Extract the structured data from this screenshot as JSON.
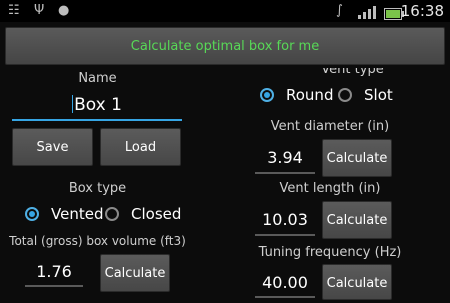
{
  "status": {
    "time": "16:38",
    "icons": [
      "usb-icon",
      "usb-debug-icon",
      "android-icon",
      "bluetooth-icon",
      "signal-icon",
      "battery-icon"
    ]
  },
  "header": {
    "calc_optimal_label": "Calculate optimal box for me"
  },
  "left": {
    "name_label": "Name",
    "name_value": "Box 1",
    "save_label": "Save",
    "load_label": "Load",
    "box_type_label": "Box type",
    "box_type_options": [
      "Vented",
      "Closed"
    ],
    "box_type_selected": "Vented",
    "volume_label": "Total (gross) box volume  (ft3)",
    "volume_value": "1.76",
    "calc_label": "Calculate"
  },
  "right": {
    "vent_type_label": "Vent type",
    "vent_type_options": [
      "Round",
      "Slot"
    ],
    "vent_type_selected": "Round",
    "vent_diameter_label": "Vent diameter  (in)",
    "vent_diameter_value": "3.94",
    "vent_length_label": "Vent length  (in)",
    "vent_length_value": "10.03",
    "tuning_label": "Tuning frequency (Hz)",
    "tuning_value": "40.00",
    "calc_label": "Calculate"
  },
  "colors": {
    "accent_blue": "#36a5e4",
    "green_text": "#58d957"
  }
}
